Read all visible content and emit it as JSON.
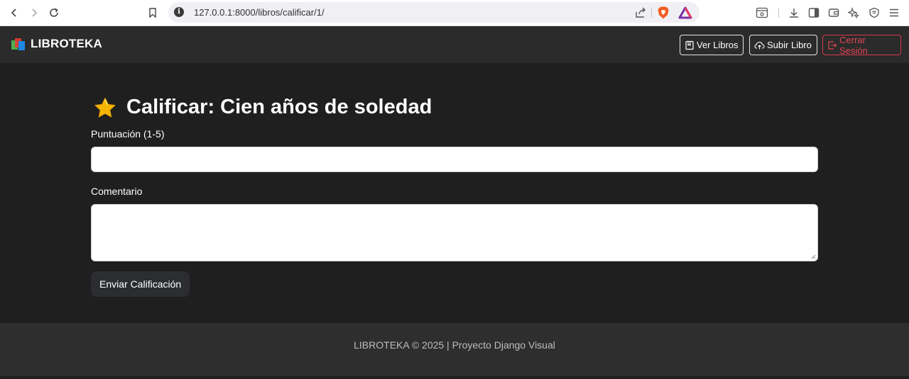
{
  "browser": {
    "url": "127.0.0.1:8000/libros/calificar/1/",
    "info_icon": "info-icon"
  },
  "header": {
    "brand": "LIBROTEKA",
    "buttons": {
      "ver_libros": "Ver Libros",
      "subir_libro": "Subir Libro",
      "cerrar_sesion": "Cerrar Sesión"
    }
  },
  "page": {
    "title": "Calificar: Cien años de soledad",
    "title_icon": "star-icon",
    "form": {
      "score_label": "Puntuación (1-5)",
      "score_value": "",
      "comment_label": "Comentario",
      "comment_value": "",
      "submit_label": "Enviar Calificación"
    }
  },
  "footer": {
    "text": "LIBROTEKA © 2025 | Proyecto Django Visual"
  },
  "colors": {
    "background": "#1f1f1f",
    "header_bg": "#2b2b2b",
    "footer_bg": "#2e2e2e",
    "danger": "#e14553",
    "star": "#f4b400"
  }
}
